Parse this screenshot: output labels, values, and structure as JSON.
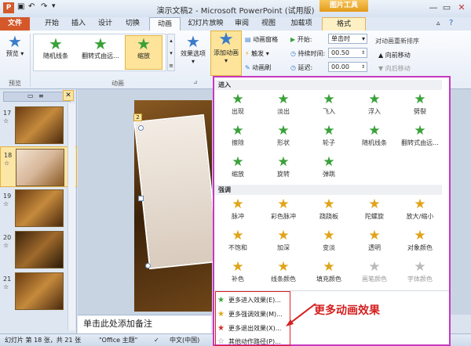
{
  "window": {
    "title": "演示文稿2 - Microsoft PowerPoint (试用版)",
    "context_tab_title": "图片工具"
  },
  "tabs": [
    "文件",
    "开始",
    "插入",
    "设计",
    "切换",
    "动画",
    "幻灯片放映",
    "审阅",
    "视图",
    "加载项",
    "格式"
  ],
  "ribbon": {
    "preview": "预览",
    "preview_group": "预览",
    "gallery": [
      "随机线条",
      "翻转式由远...",
      "缩放"
    ],
    "effect_options": "效果选项",
    "animation_group": "动画",
    "add_animation": "添加动画",
    "anim_pane": "动画窗格",
    "trigger": "触发",
    "anim_painter": "动画刷",
    "start_label": "开始:",
    "start_value": "单击时",
    "duration_label": "持续时间:",
    "duration_value": "00.50",
    "delay_label": "延迟:",
    "delay_value": "00.00",
    "reorder": "对动画重新排序",
    "move_earlier": "向前移动",
    "move_later": "向后移动"
  },
  "thumbs": [
    "17",
    "18",
    "19",
    "20",
    "21"
  ],
  "slide_badge": "2",
  "notes_placeholder": "单击此处添加备注",
  "status": {
    "slide_info": "幻灯片 第 18 张，共 21 张",
    "theme": "\"Office 主题\"",
    "lang": "中文(中国)"
  },
  "dropdown": {
    "entrance_header": "进入",
    "entrance": [
      "出现",
      "淡出",
      "飞入",
      "浮入",
      "劈裂",
      "擦除",
      "形状",
      "轮子",
      "随机线条",
      "翻转式由远...",
      "缩放",
      "旋转",
      "弹跳"
    ],
    "emphasis_header": "强调",
    "emphasis": [
      "脉冲",
      "彩色脉冲",
      "跷跷板",
      "陀螺旋",
      "放大/缩小",
      "不饱和",
      "加深",
      "变淡",
      "透明",
      "对象颜色",
      "补色",
      "线条颜色",
      "填充颜色",
      "画笔颜色",
      "字体颜色"
    ],
    "menu": [
      "更多进入效果(E)...",
      "更多强调效果(M)...",
      "更多退出效果(X)...",
      "其他动作路径(P)..."
    ]
  },
  "annotation": "更多动画效果",
  "colors": {
    "entrance": "#3aa13a",
    "emphasis": "#e0a419",
    "exit": "#c8302a",
    "accent": "#c838c0",
    "file_tab": "#d4582a"
  }
}
